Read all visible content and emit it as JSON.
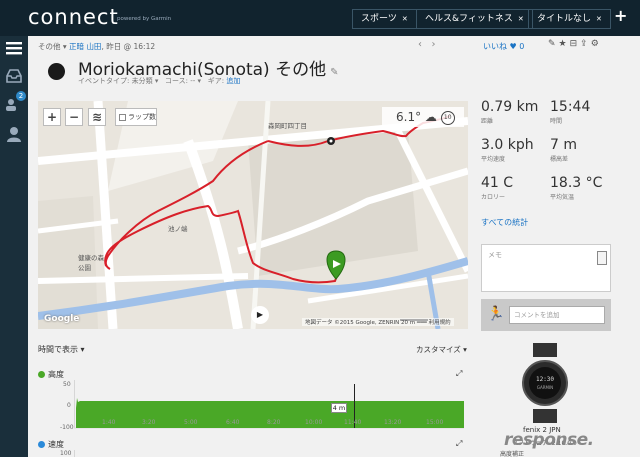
{
  "app": {
    "logo": "connect",
    "logo_sub": "powered by Garmin",
    "nav": [
      "スポーツ",
      "ヘルス&フィットネス",
      "タイトルなし"
    ],
    "badge_count": "2"
  },
  "activity": {
    "breadcrumb_prefix": "その他",
    "location": "正暗",
    "place": "山田",
    "date": "昨日",
    "time": "@ 16:12",
    "likes": "いいね",
    "like_count": "0",
    "title": "Moriokamachi(Sonota) その他",
    "type_label": "イベントタイプ:",
    "type_value": "未分類",
    "course_label": "コース:",
    "course_value": "--",
    "gear_label": "ギア:",
    "gear_value": "追加"
  },
  "map": {
    "lap_label": "ラップ数",
    "temp": "6.1°",
    "wind": "10",
    "labels": {
      "station": "森岡町四丁目",
      "park": "健康の森\n公園",
      "pond": "池ノ端"
    },
    "google": "Google",
    "attribution": "地図データ ©2015 Google, ZENRIN   20 m ━━━   利用規約"
  },
  "stats": [
    {
      "value": "0.79 km",
      "label": "距離"
    },
    {
      "value": "15:44",
      "label": "時間"
    },
    {
      "value": "3.0 kph",
      "label": "平均速度"
    },
    {
      "value": "7 m",
      "label": "標高差"
    },
    {
      "value": "41 C",
      "label": "カロリー"
    },
    {
      "value": "18.3 °C",
      "label": "平均気温"
    }
  ],
  "all_stats": "すべての統計",
  "memo_placeholder": "メモ",
  "comment_placeholder": "コメントを追加",
  "charts": {
    "view_label": "時間で表示",
    "customize": "カスタマイズ",
    "elevation": {
      "title": "高度",
      "color": "#4aa827",
      "y_labels": [
        "50",
        "0",
        "-100"
      ],
      "x_labels": [
        "1:40",
        "3:20",
        "5:00",
        "6:40",
        "8:20",
        "10:00",
        "11:40",
        "13:20",
        "15:00"
      ],
      "tooltip": "4 m"
    },
    "speed": {
      "title": "速度",
      "color": "#2b8ad9",
      "y_labels": [
        "100"
      ]
    }
  },
  "device": {
    "name": "fenix 2 JPN",
    "software": "ソフトウェア: 2.10.0.0",
    "more": "高度補正"
  },
  "watermark": "response."
}
